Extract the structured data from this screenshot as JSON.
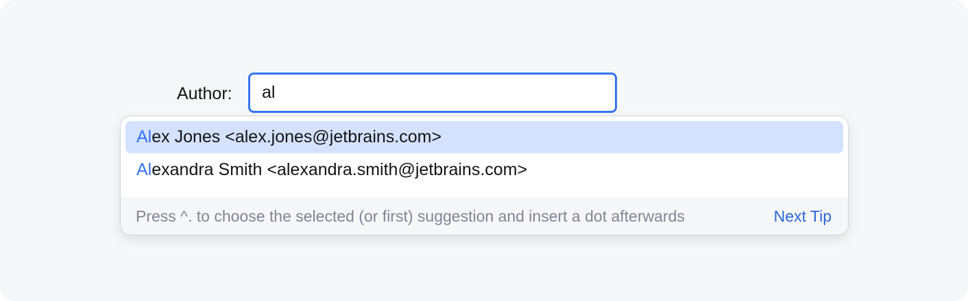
{
  "form": {
    "author_label": "Author:",
    "author_value": "al"
  },
  "completion": {
    "items": [
      {
        "match": "Al",
        "rest": "ex Jones <alex.jones@jetbrains.com>",
        "selected": true
      },
      {
        "match": "Al",
        "rest": "exandra Smith <alexandra.smith@jetbrains.com>",
        "selected": false
      }
    ],
    "footer": {
      "tip": "Press ^. to choose the selected (or first) suggestion and insert a dot afterwards",
      "next_tip_label": "Next Tip"
    }
  },
  "colors": {
    "accent": "#3574f0",
    "selection": "#d4e2ff",
    "link": "#2a66d9",
    "muted_text": "#818594"
  }
}
